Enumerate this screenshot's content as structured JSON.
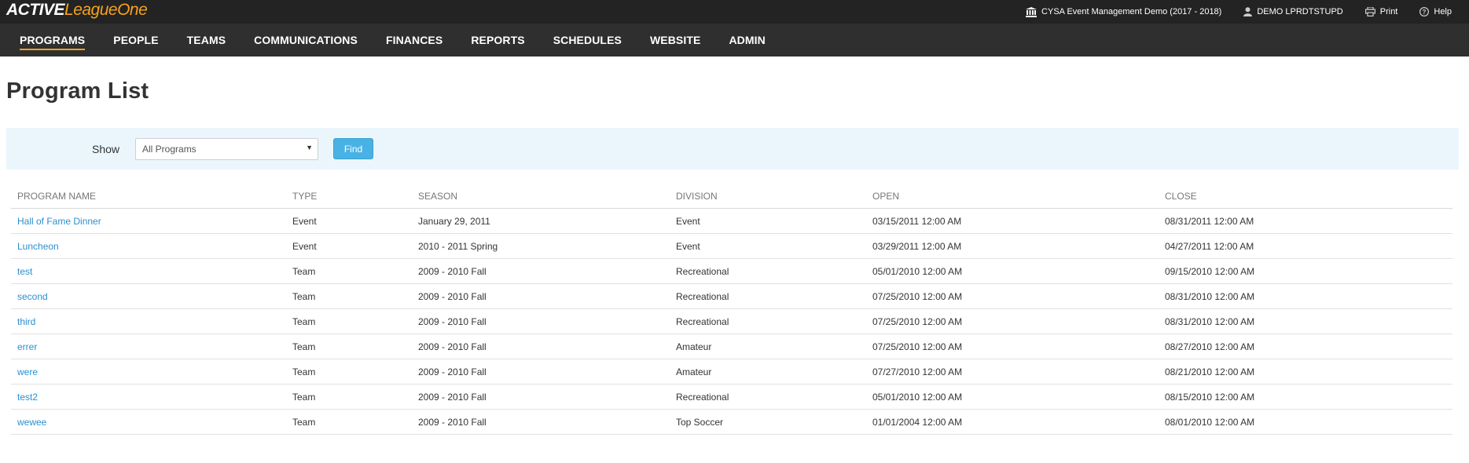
{
  "brand": {
    "part1": "ACTIVE",
    "part2": "LeagueOne"
  },
  "topbar": {
    "org": "CYSA Event Management Demo (2017 - 2018)",
    "user": "DEMO LPRDTSTUPD",
    "print": "Print",
    "help": "Help"
  },
  "nav": [
    "PROGRAMS",
    "PEOPLE",
    "TEAMS",
    "COMMUNICATIONS",
    "FINANCES",
    "REPORTS",
    "SCHEDULES",
    "WEBSITE",
    "ADMIN"
  ],
  "page": {
    "title": "Program List"
  },
  "filter": {
    "show_label": "Show",
    "select_value": "All Programs",
    "find_label": "Find"
  },
  "table": {
    "columns": [
      "PROGRAM NAME",
      "TYPE",
      "SEASON",
      "DIVISION",
      "OPEN",
      "CLOSE"
    ],
    "rows": [
      [
        "Hall of Fame Dinner",
        "Event",
        "January 29, 2011",
        "Event",
        "03/15/2011 12:00 AM",
        "08/31/2011 12:00 AM"
      ],
      [
        "Luncheon",
        "Event",
        "2010 - 2011 Spring",
        "Event",
        "03/29/2011 12:00 AM",
        "04/27/2011 12:00 AM"
      ],
      [
        "test",
        "Team",
        "2009 - 2010 Fall",
        "Recreational",
        "05/01/2010 12:00 AM",
        "09/15/2010 12:00 AM"
      ],
      [
        "second",
        "Team",
        "2009 - 2010 Fall",
        "Recreational",
        "07/25/2010 12:00 AM",
        "08/31/2010 12:00 AM"
      ],
      [
        "third",
        "Team",
        "2009 - 2010 Fall",
        "Recreational",
        "07/25/2010 12:00 AM",
        "08/31/2010 12:00 AM"
      ],
      [
        "errer",
        "Team",
        "2009 - 2010 Fall",
        "Amateur",
        "07/25/2010 12:00 AM",
        "08/27/2010 12:00 AM"
      ],
      [
        "were",
        "Team",
        "2009 - 2010 Fall",
        "Amateur",
        "07/27/2010 12:00 AM",
        "08/21/2010 12:00 AM"
      ],
      [
        "test2",
        "Team",
        "2009 - 2010 Fall",
        "Recreational",
        "05/01/2010 12:00 AM",
        "08/15/2010 12:00 AM"
      ],
      [
        "wewee",
        "Team",
        "2009 - 2010 Fall",
        "Top Soccer",
        "01/01/2004 12:00 AM",
        "08/01/2010 12:00 AM"
      ]
    ]
  },
  "colors": {
    "accent": "#f7a21b",
    "link": "#2a8fd0",
    "button": "#49b2e5",
    "topbar": "#232323",
    "navbar": "#2f2f2f"
  },
  "icons": {
    "org": "institution-icon",
    "user": "user-icon",
    "print": "printer-icon",
    "help": "help-icon"
  }
}
